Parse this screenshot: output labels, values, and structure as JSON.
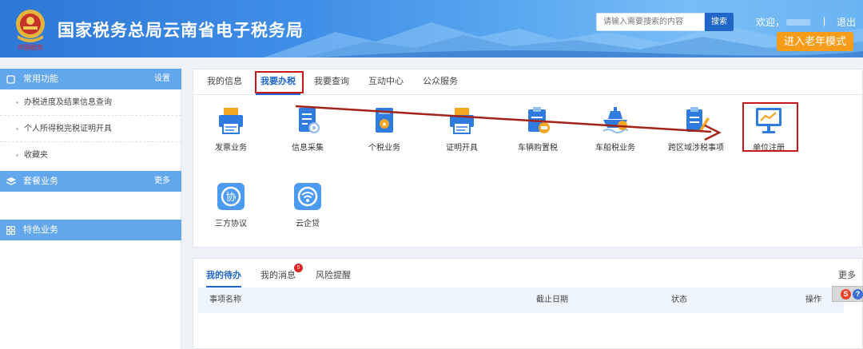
{
  "header": {
    "title": "国家税务总局云南省电子税务局",
    "search": {
      "placeholder": "请输入需要搜索的内容",
      "button_label": "搜索"
    },
    "welcome": "欢迎，",
    "separator": "|",
    "logout": "退出",
    "elder_mode": "进入老年模式",
    "emblem_text": "中国税务"
  },
  "sidebar": {
    "common": {
      "title": "常用功能",
      "action": "设置",
      "icon": "window-icon"
    },
    "common_items": [
      {
        "label": "办税进度及结果信息查询"
      },
      {
        "label": "个人所得税完税证明开具"
      },
      {
        "label": "收藏夹"
      }
    ],
    "package": {
      "title": "套餐业务",
      "action": "更多",
      "icon": "layers-icon"
    },
    "special": {
      "title": "特色业务",
      "icon": "grid-icon"
    }
  },
  "main_tabs": [
    {
      "label": "我的信息"
    },
    {
      "label": "我要办税"
    },
    {
      "label": "我要查询"
    },
    {
      "label": "互动中心"
    },
    {
      "label": "公众服务"
    }
  ],
  "services": [
    {
      "label": "发票业务",
      "icon": "printer-icon"
    },
    {
      "label": "信息采集",
      "icon": "document-icon"
    },
    {
      "label": "个税业务",
      "icon": "tax-card-icon"
    },
    {
      "label": "证明开具",
      "icon": "printer-icon"
    },
    {
      "label": "车辆购置税",
      "icon": "vehicle-tax-icon"
    },
    {
      "label": "车船税业务",
      "icon": "ship-tax-icon"
    },
    {
      "label": "跨区域涉税事项",
      "icon": "cross-region-icon"
    },
    {
      "label": "单位注册",
      "icon": "monitor-chart-icon"
    },
    {
      "label": "三方协议",
      "icon": "agreement-icon",
      "glyph": "协"
    },
    {
      "label": "云企贷",
      "icon": "cloud-loan-icon"
    }
  ],
  "todo": {
    "tabs": [
      {
        "label": "我的待办"
      },
      {
        "label": "我的消息",
        "badge": "5"
      },
      {
        "label": "风险提醒"
      }
    ],
    "more": "更多",
    "columns": [
      "事项名称",
      "截止日期",
      "状态",
      "操作"
    ]
  },
  "float_tool": {
    "s": "S",
    "q": "?"
  },
  "colors": {
    "brand_blue": "#1f66c8",
    "sidebar_head": "#62a6ec",
    "elder_orange": "#f59c1b",
    "highlight_red": "#c6181a"
  }
}
